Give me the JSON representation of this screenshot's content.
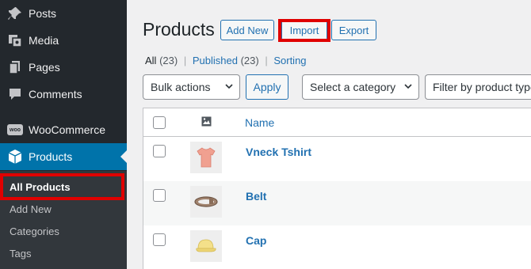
{
  "sidebar": {
    "items": [
      {
        "label": "Posts",
        "icon": "pin-icon"
      },
      {
        "label": "Media",
        "icon": "media-icon"
      },
      {
        "label": "Pages",
        "icon": "pages-icon"
      },
      {
        "label": "Comments",
        "icon": "comments-icon"
      },
      {
        "label": "WooCommerce",
        "icon": "woocommerce-icon"
      },
      {
        "label": "Products",
        "icon": "box-icon"
      }
    ],
    "submenu": [
      "All Products",
      "Add New",
      "Categories",
      "Tags"
    ],
    "woo_badge": "woo"
  },
  "header": {
    "title": "Products",
    "buttons": [
      "Add New",
      "Import",
      "Export"
    ]
  },
  "filters": {
    "status_links": [
      {
        "label": "All",
        "count": "(23)"
      },
      {
        "label": "Published",
        "count": "(23)"
      },
      {
        "label": "Sorting",
        "count": ""
      }
    ],
    "separator": "|",
    "bulk_actions": "Bulk actions",
    "apply": "Apply",
    "category": "Select a category",
    "product_type": "Filter by product type"
  },
  "table": {
    "columns": {
      "name": "Name"
    },
    "rows": [
      {
        "name": "Vneck Tshirt",
        "thumb": "tshirt-thumbnail"
      },
      {
        "name": "Belt",
        "thumb": "belt-thumbnail"
      },
      {
        "name": "Cap",
        "thumb": "cap-thumbnail"
      }
    ]
  },
  "colors": {
    "sidebar_bg": "#23282d",
    "submenu_bg": "#32373c",
    "active_bg": "#0073aa",
    "link": "#2271b1",
    "highlight": "#e00000"
  }
}
